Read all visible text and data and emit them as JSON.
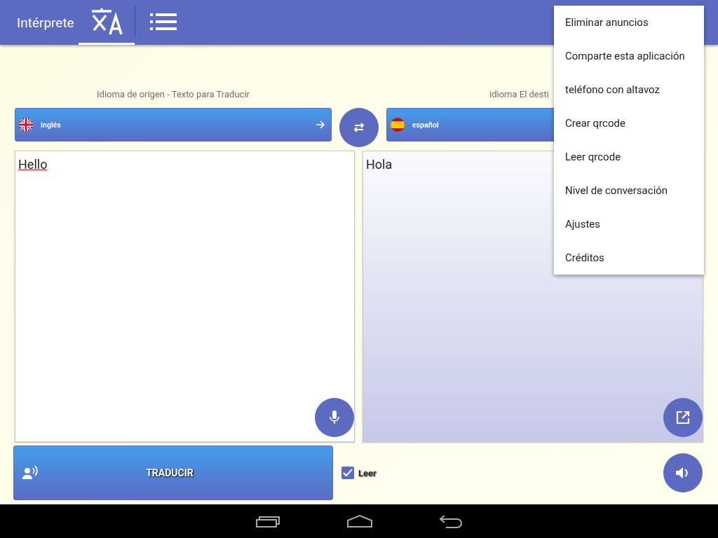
{
  "app_bar": {
    "title": "Intérprete",
    "tabs": [
      {
        "kind": "translate",
        "selected": true
      },
      {
        "kind": "list",
        "selected": false
      }
    ]
  },
  "source": {
    "caption": "Idioma de origen - Texto para Traducir",
    "language": "inglés",
    "text": "Hello"
  },
  "target": {
    "caption": "idioma El desti",
    "language": "español",
    "text": "Hola"
  },
  "translate_button": "TRADUCIR",
  "read_checkbox": {
    "label": "Leer",
    "checked": true
  },
  "menu": [
    "Eliminar anuncios",
    "Comparte esta aplicación",
    "teléfono con altavoz",
    "Crear qrcode",
    "Leer qrcode",
    "Nivel de conversación",
    "Ajustes",
    "Créditos"
  ]
}
